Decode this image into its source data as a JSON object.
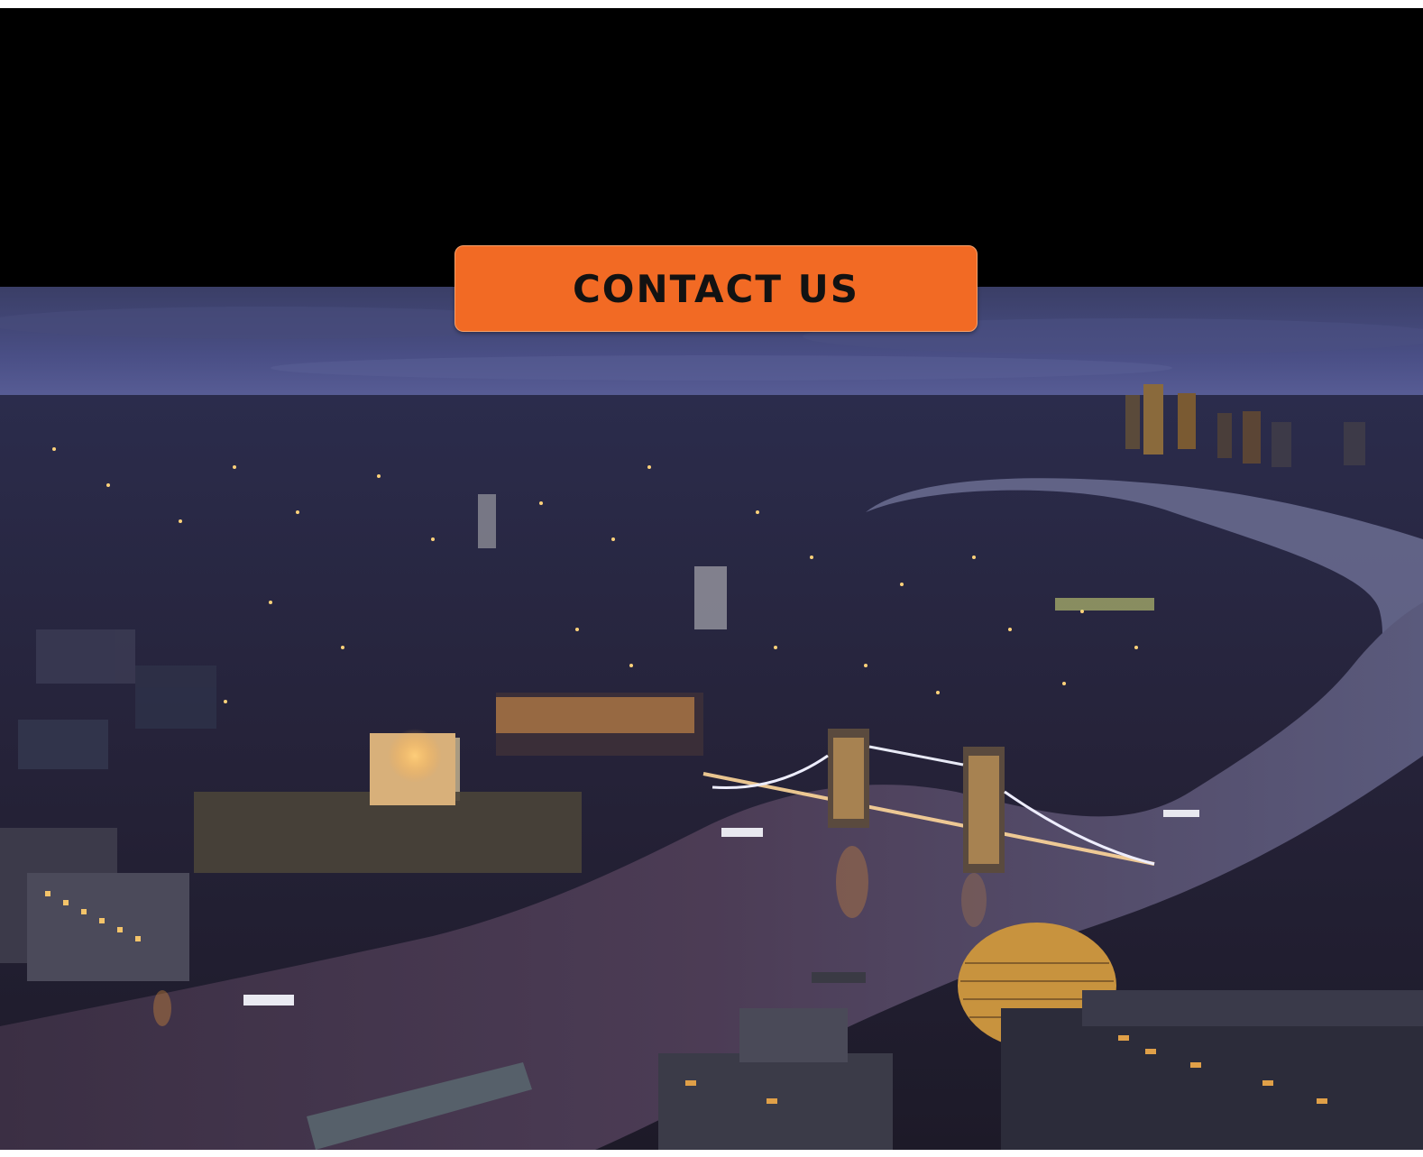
{
  "hero": {
    "image_description_name": "london-night-skyline-photo"
  },
  "cta": {
    "label": "CONTACT US",
    "background_color": "#f26a24",
    "text_color": "#121212"
  },
  "colors": {
    "band": "#000000",
    "sky": "#3d4270",
    "river": "#4a3a52",
    "accent": "#f26a24"
  }
}
